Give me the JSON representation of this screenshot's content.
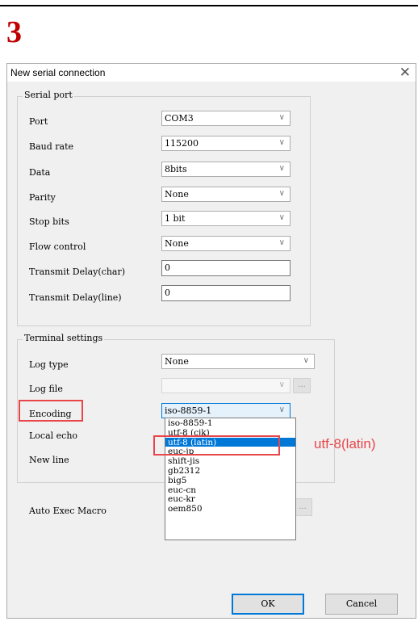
{
  "step_number": "3",
  "dialog": {
    "title": "New serial connection",
    "close_glyph": "✕"
  },
  "serial_port": {
    "legend": "Serial port",
    "port": {
      "label": "Port",
      "value": "COM3"
    },
    "baud_rate": {
      "label": "Baud rate",
      "value": "115200"
    },
    "data": {
      "label": "Data",
      "value": "8bits"
    },
    "parity": {
      "label": "Parity",
      "value": "None"
    },
    "stop_bits": {
      "label": "Stop bits",
      "value": "1 bit"
    },
    "flow_control": {
      "label": "Flow control",
      "value": "None"
    },
    "transmit_delay_char": {
      "label": "Transmit Delay(char)",
      "value": "0"
    },
    "transmit_delay_line": {
      "label": "Transmit Delay(line)",
      "value": "0"
    }
  },
  "terminal_settings": {
    "legend": "Terminal settings",
    "log_type": {
      "label": "Log type",
      "value": "None"
    },
    "log_file": {
      "label": "Log file",
      "value": "",
      "browse": "..."
    },
    "encoding": {
      "label": "Encoding",
      "value": "iso-8859-1"
    },
    "local_echo": {
      "label": "Local echo"
    },
    "new_line": {
      "label": "New line"
    }
  },
  "encoding_options": [
    "iso-8859-1",
    "utf-8 (cjk)",
    "utf-8 (latin)",
    "euc-jp",
    "shift-jis",
    "gb2312",
    "big5",
    "euc-cn",
    "euc-kr",
    "oem850"
  ],
  "selected_encoding_index": 2,
  "auto_exec_macro": {
    "label": "Auto Exec Macro",
    "browse": "..."
  },
  "annotation": {
    "text": "utf-8(latin)",
    "color": "#e8464a"
  },
  "buttons": {
    "ok": "OK",
    "cancel": "Cancel"
  },
  "colors": {
    "accent": "#0078d7",
    "step": "#c00000"
  },
  "icons": {
    "dropdown": "chevron-down-icon",
    "close": "close-icon"
  }
}
